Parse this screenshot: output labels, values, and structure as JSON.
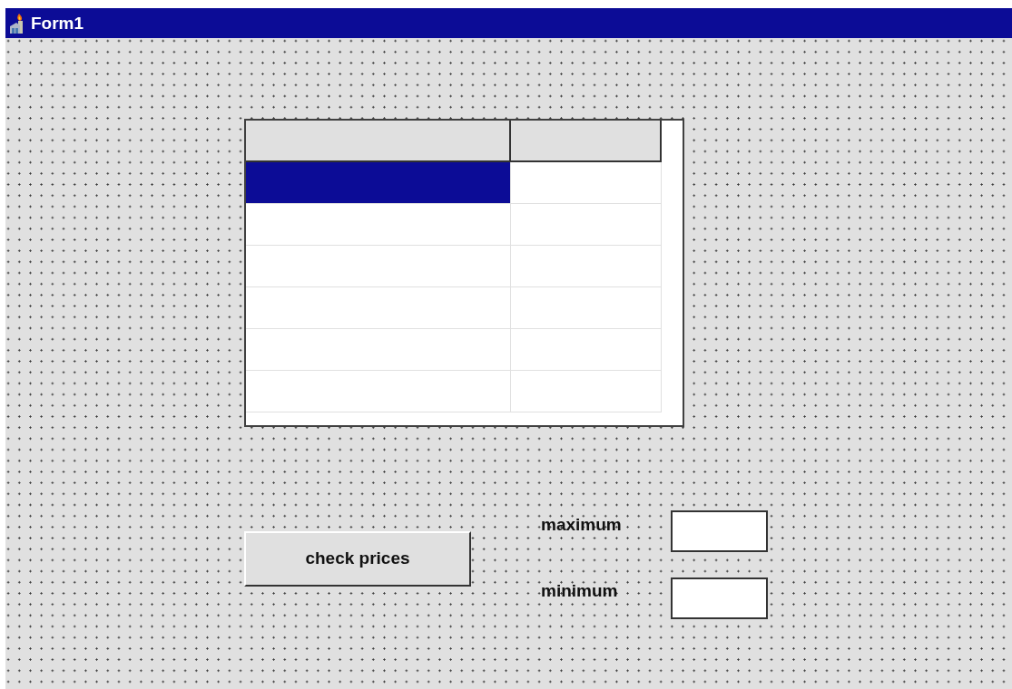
{
  "window": {
    "title": "Form1"
  },
  "grid": {
    "rows": [
      {
        "cells": [
          {
            "selected": true
          },
          {
            "selected": false
          }
        ]
      },
      {
        "cells": [
          {
            "selected": false
          },
          {
            "selected": false
          }
        ]
      },
      {
        "cells": [
          {
            "selected": false
          },
          {
            "selected": false
          }
        ]
      },
      {
        "cells": [
          {
            "selected": false
          },
          {
            "selected": false
          }
        ]
      },
      {
        "cells": [
          {
            "selected": false
          },
          {
            "selected": false
          }
        ]
      },
      {
        "cells": [
          {
            "selected": false
          },
          {
            "selected": false
          }
        ]
      }
    ]
  },
  "button": {
    "label": "check prices"
  },
  "fields": [
    {
      "label": "maximum"
    },
    {
      "label": "minimum"
    }
  ]
}
